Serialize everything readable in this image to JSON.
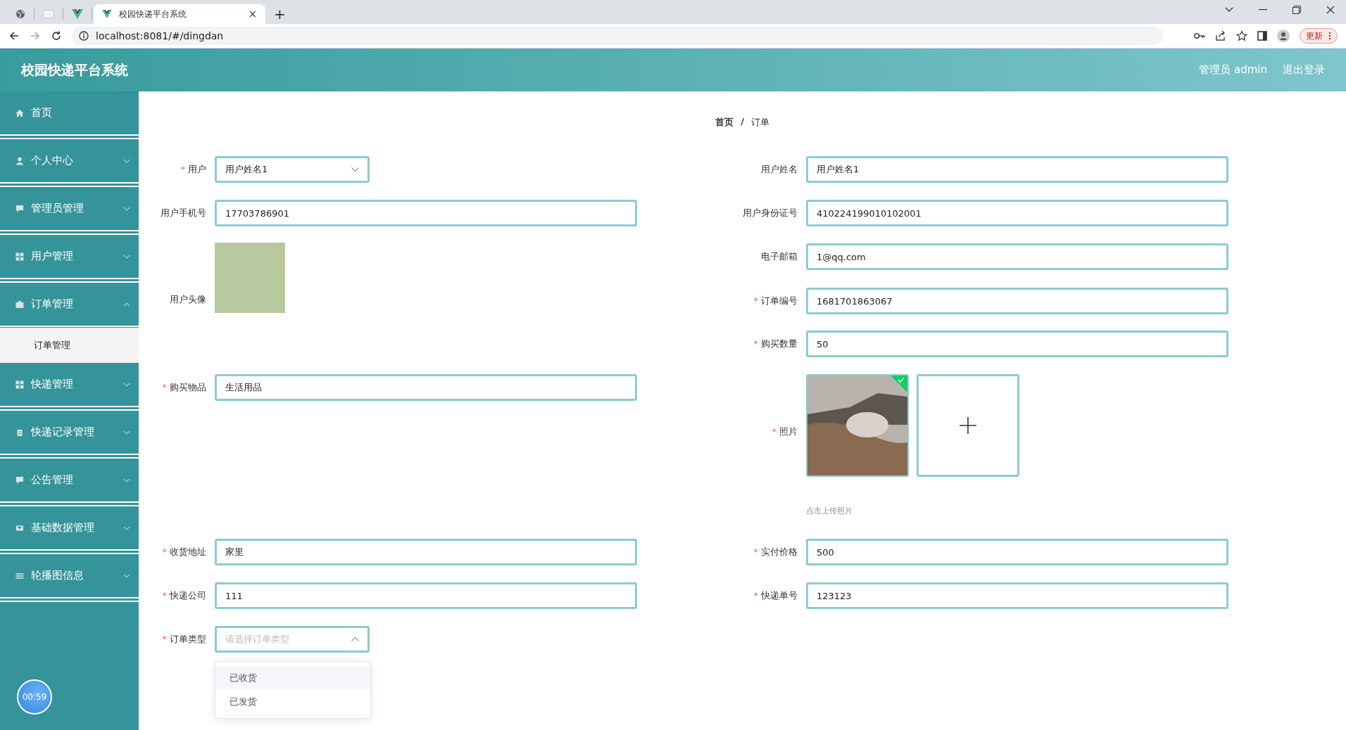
{
  "browser": {
    "tabs": [
      {
        "kind": "globe",
        "selected": false
      },
      {
        "kind": "blank",
        "selected": false
      },
      {
        "kind": "vue",
        "selected": false
      },
      {
        "kind": "page",
        "title": "校园快递平台系统",
        "close": "×",
        "selected": true
      }
    ],
    "new_tab": "+",
    "url": "localhost:8081/#/dingdan",
    "update_button": "更新"
  },
  "header": {
    "title": "校园快递平台系统",
    "user": "管理员 admin",
    "logout": "退出登录"
  },
  "sidebar": {
    "items": [
      {
        "kind": "link",
        "label": "首页"
      },
      {
        "kind": "menu",
        "label": "个人中心",
        "expanded": false
      },
      {
        "kind": "menu",
        "label": "管理员管理",
        "expanded": false
      },
      {
        "kind": "menu",
        "label": "用户管理",
        "expanded": false
      },
      {
        "kind": "menu",
        "label": "订单管理",
        "expanded": true,
        "children": [
          {
            "label": "订单管理"
          }
        ]
      },
      {
        "kind": "menu",
        "label": "快递管理",
        "expanded": false
      },
      {
        "kind": "menu",
        "label": "快递记录管理",
        "expanded": false
      },
      {
        "kind": "menu",
        "label": "公告管理",
        "expanded": false
      },
      {
        "kind": "menu",
        "label": "基础数据管理",
        "expanded": false
      },
      {
        "kind": "menu",
        "label": "轮播图信息",
        "expanded": false
      }
    ],
    "timer": "00:59"
  },
  "breadcrumb": [
    "首页",
    "订单"
  ],
  "breadcrumb_separator": "/",
  "form": {
    "required_mark": "*",
    "left": [
      {
        "kind": "select",
        "label": "用户",
        "required": true,
        "value": "用户姓名1",
        "expanded": false
      },
      {
        "kind": "text",
        "label": "用户手机号",
        "required": false,
        "value": "17703786901"
      },
      {
        "kind": "image",
        "label": "用户头像",
        "required": false
      },
      {
        "kind": "text",
        "label": "购买物品",
        "required": true,
        "value": "生活用品"
      },
      {
        "kind": "text",
        "label": "收货地址",
        "required": true,
        "value": "家里"
      },
      {
        "kind": "text",
        "label": "快递公司",
        "required": true,
        "value": "111"
      },
      {
        "kind": "select",
        "label": "订单类型",
        "required": true,
        "placeholder": "请选择订单类型",
        "expanded": true,
        "options": [
          {
            "label": "已收货",
            "highlighted": true
          },
          {
            "label": "已发货",
            "highlighted": false
          }
        ]
      }
    ],
    "right": [
      {
        "kind": "text",
        "label": "用户姓名",
        "required": false,
        "value": "用户姓名1"
      },
      {
        "kind": "text",
        "label": "用户身份证号",
        "required": false,
        "value": "410224199010102001"
      },
      {
        "kind": "text",
        "label": "电子邮箱",
        "required": false,
        "value": "1@qq.com"
      },
      {
        "kind": "text",
        "label": "订单编号",
        "required": true,
        "value": "1681701863067"
      },
      {
        "kind": "text",
        "label": "购买数量",
        "required": true,
        "value": "50"
      },
      {
        "kind": "upload",
        "label": "照片",
        "required": true,
        "uploaded": true
      },
      {
        "kind": "hint",
        "text": "点击上传照片"
      },
      {
        "kind": "text",
        "label": "实付价格",
        "required": true,
        "value": "500"
      },
      {
        "kind": "text",
        "label": "快递单号",
        "required": true,
        "value": "123123"
      }
    ]
  }
}
